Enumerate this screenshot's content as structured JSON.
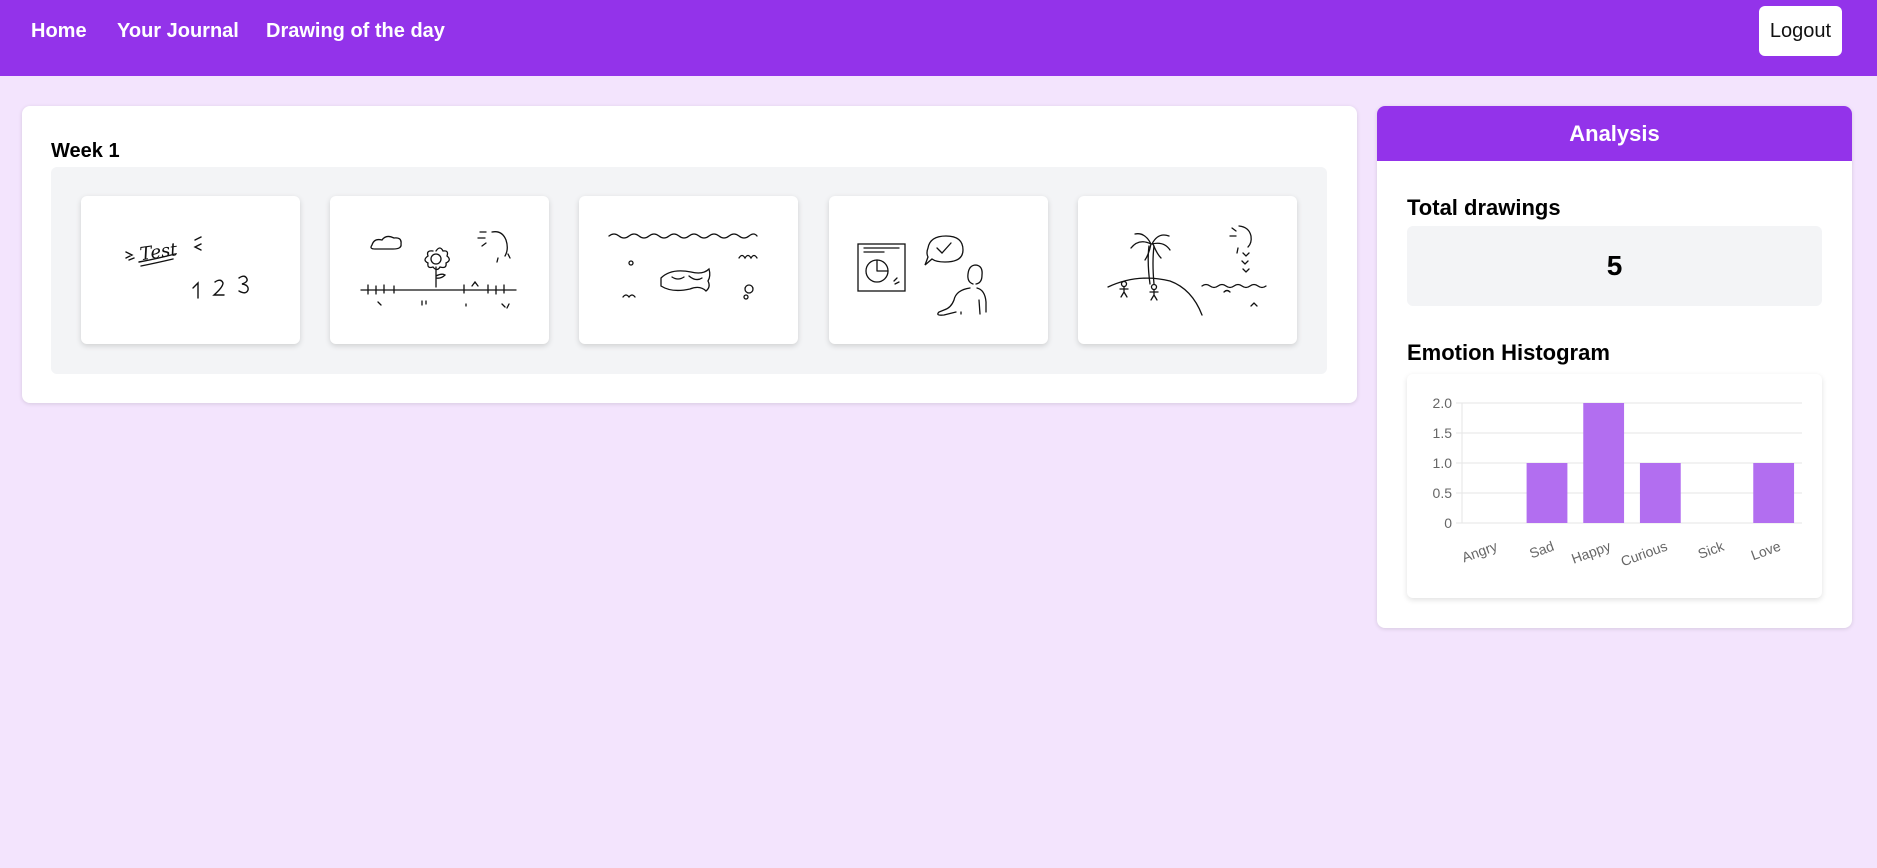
{
  "nav": {
    "home": "Home",
    "journal": "Your Journal",
    "drawing_of_day": "Drawing of the day",
    "logout": "Logout"
  },
  "journal": {
    "week_title": "Week 1",
    "drawings": [
      {
        "name": "drawing-test-123",
        "caption": "Test"
      },
      {
        "name": "drawing-flower-field"
      },
      {
        "name": "drawing-fish-sea"
      },
      {
        "name": "drawing-presentation"
      },
      {
        "name": "drawing-beach-palm"
      }
    ]
  },
  "analysis": {
    "header": "Analysis",
    "total_title": "Total drawings",
    "total_value": "5",
    "histogram_title": "Emotion Histogram"
  },
  "colors": {
    "accent": "#9333ea",
    "bar": "#b26ef0",
    "background": "#f3e4fd"
  },
  "chart_data": {
    "type": "bar",
    "categories": [
      "Angry",
      "Sad",
      "Happy",
      "Curious",
      "Sick",
      "Love"
    ],
    "values": [
      0,
      1,
      2,
      1,
      0,
      1
    ],
    "ylim": [
      0,
      2
    ],
    "yticks": [
      "0",
      "0.5",
      "1.0",
      "1.5",
      "2.0"
    ],
    "grid": true,
    "legend": "none"
  }
}
